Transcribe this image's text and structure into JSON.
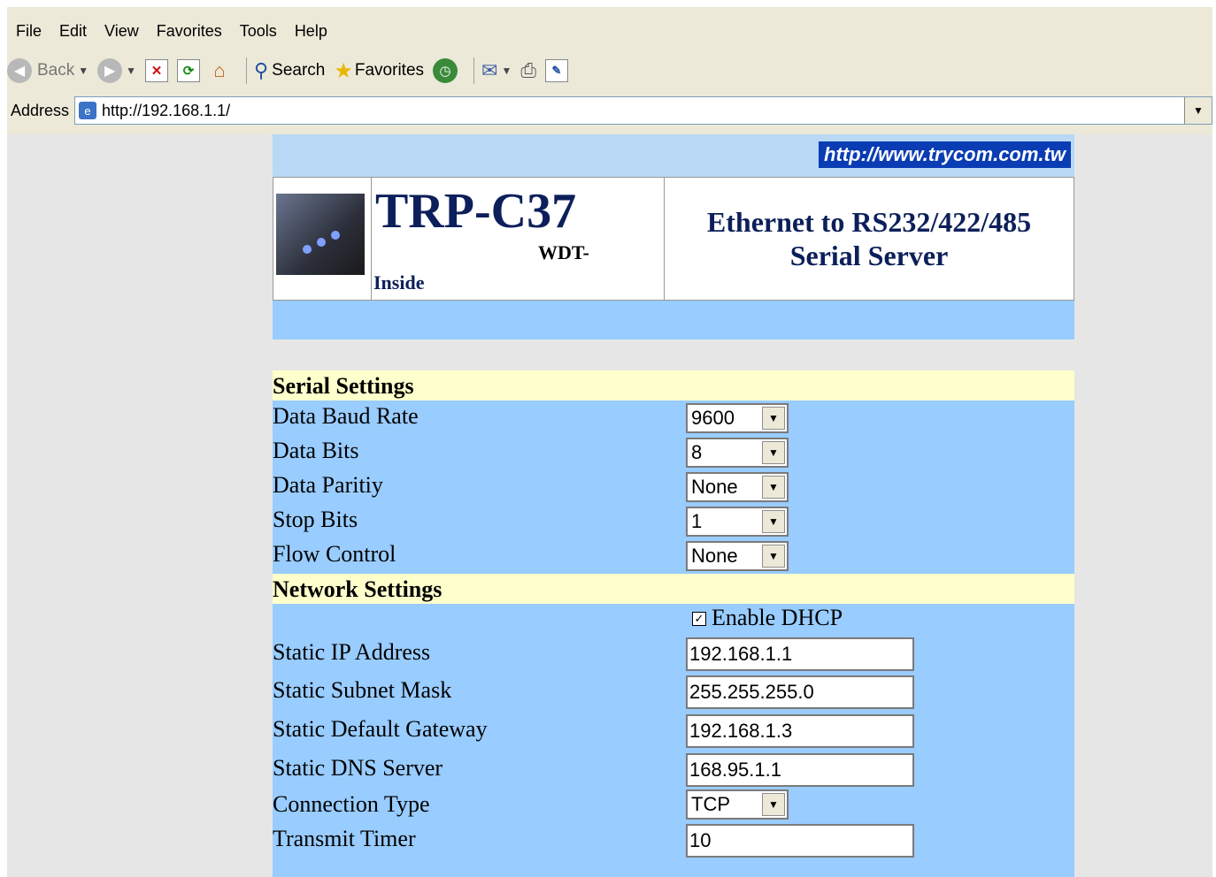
{
  "menu": [
    "File",
    "Edit",
    "View",
    "Favorites",
    "Tools",
    "Help"
  ],
  "toolbar": {
    "back": "Back",
    "search": "Search",
    "favorites": "Favorites"
  },
  "address": {
    "label": "Address",
    "url": "http://192.168.1.1/"
  },
  "page": {
    "site_url": "http://www.trycom.com.tw",
    "model": "TRP-C37",
    "wdt": "WDT-",
    "inside": "Inside",
    "description_line1": "Ethernet to RS232/422/485",
    "description_line2": "Serial Server"
  },
  "serial": {
    "heading": "Serial Settings",
    "baud_label": "Data Baud Rate",
    "baud_value": "9600",
    "bits_label": "Data Bits",
    "bits_value": "8",
    "parity_label": "Data Paritiy",
    "parity_value": "None",
    "stop_label": "Stop Bits",
    "stop_value": "1",
    "flow_label": "Flow Control",
    "flow_value": "None"
  },
  "network": {
    "heading": "Network Settings",
    "dhcp_label": "Enable DHCP",
    "dhcp_checked": true,
    "ip_label": "Static IP Address",
    "ip_value": "192.168.1.1",
    "mask_label": "Static Subnet Mask",
    "mask_value": "255.255.255.0",
    "gw_label": "Static Default Gateway",
    "gw_value": "192.168.1.3",
    "dns_label": "Static DNS Server",
    "dns_value": "168.95.1.1",
    "conn_label": "Connection Type",
    "conn_value": "TCP",
    "timer_label": "Transmit Timer",
    "timer_value": "10"
  }
}
